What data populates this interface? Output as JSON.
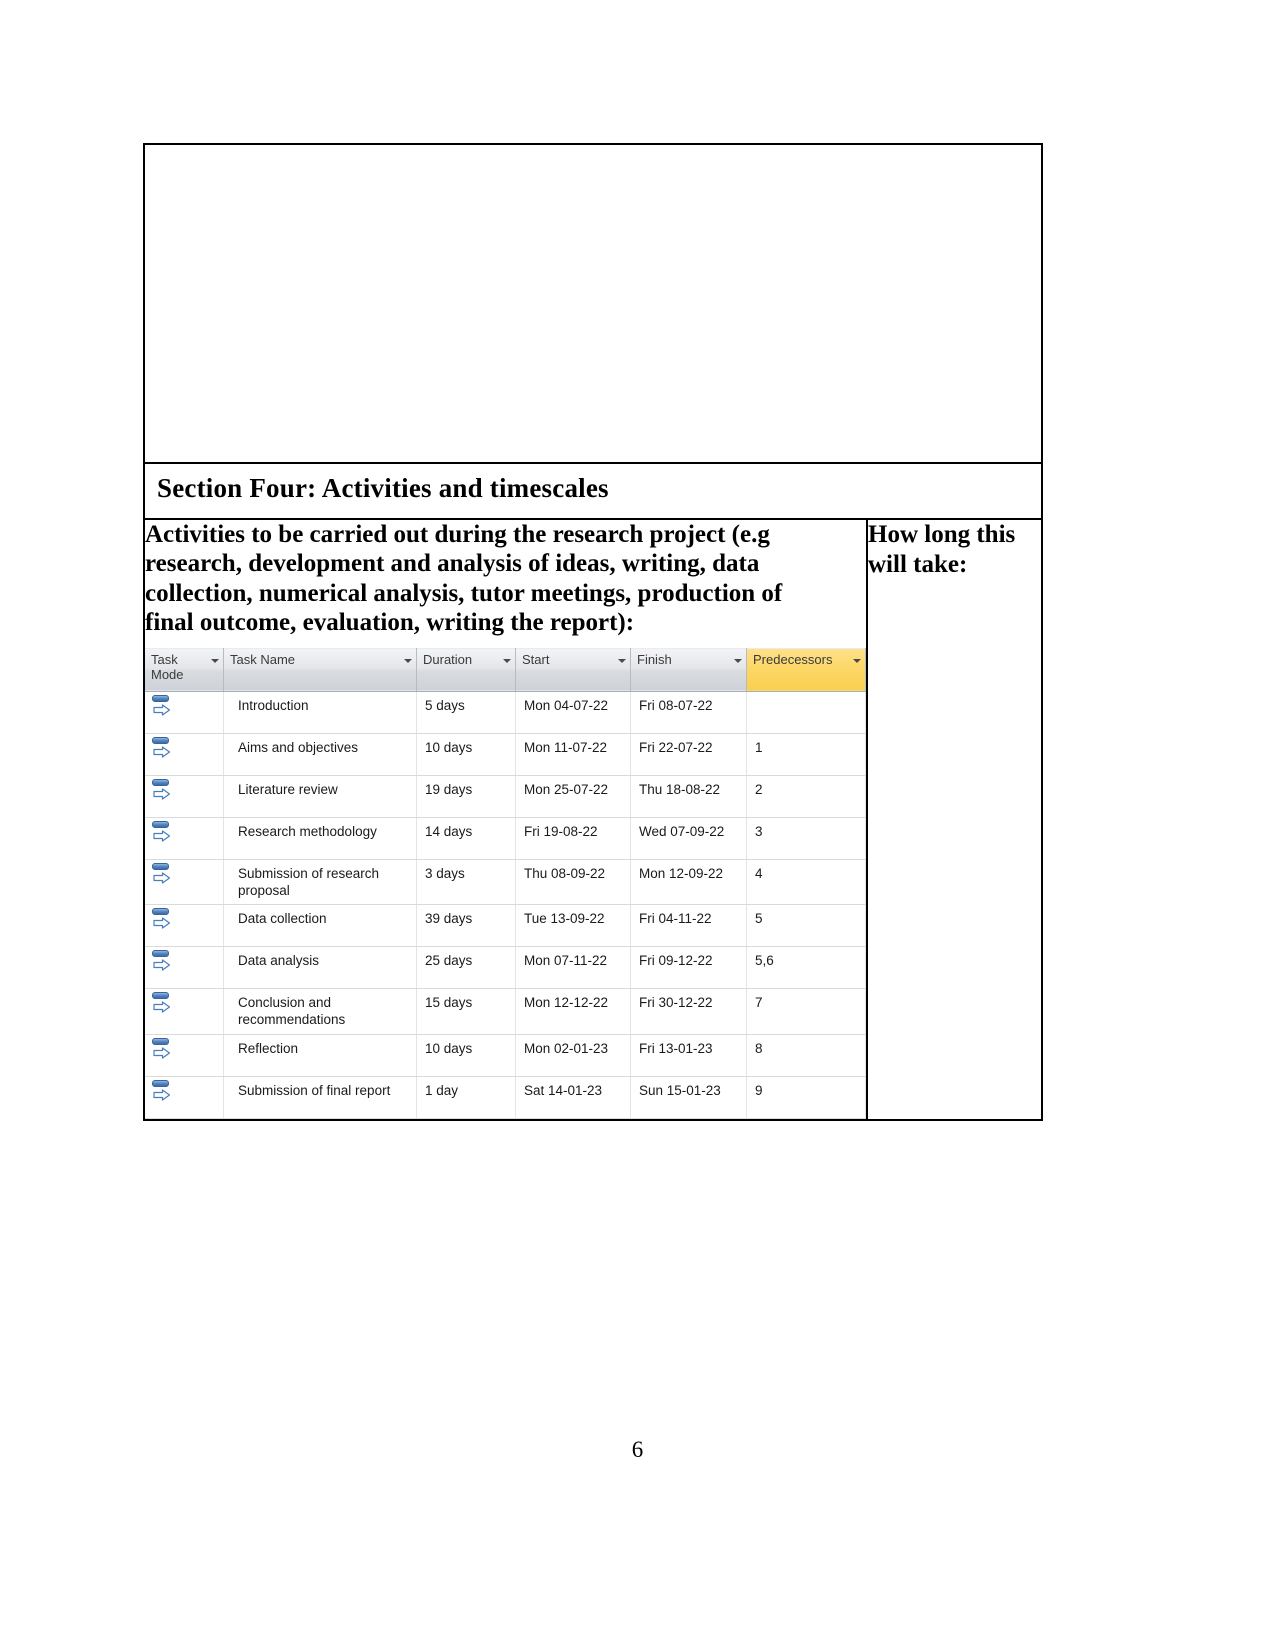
{
  "document": {
    "section_heading": "Section Four: Activities and timescales",
    "activities_prompt": "Activities to be carried out during the research project (e.g research, development and analysis of ideas, writing, data collection, numerical analysis, tutor meetings, production of final outcome, evaluation, writing the report):",
    "how_long_label": "How long this will take:",
    "page_number": "6"
  },
  "project_table": {
    "headers": [
      {
        "label": "Task Mode",
        "highlight": false
      },
      {
        "label": "Task Name",
        "highlight": false
      },
      {
        "label": "Duration",
        "highlight": false
      },
      {
        "label": "Start",
        "highlight": false
      },
      {
        "label": "Finish",
        "highlight": false
      },
      {
        "label": "Predecessors",
        "highlight": true
      }
    ],
    "accent_highlight_color": "#fbd65a",
    "header_background_color": "#dfe2e6",
    "rows": [
      {
        "mode": "auto-schedule-icon",
        "name": "Introduction",
        "duration": "5 days",
        "start": "Mon 04-07-22",
        "finish": "Fri 08-07-22",
        "predecessors": ""
      },
      {
        "mode": "auto-schedule-icon",
        "name": "Aims and objectives",
        "duration": "10 days",
        "start": "Mon 11-07-22",
        "finish": "Fri 22-07-22",
        "predecessors": "1"
      },
      {
        "mode": "auto-schedule-icon",
        "name": "Literature review",
        "duration": "19 days",
        "start": "Mon 25-07-22",
        "finish": "Thu 18-08-22",
        "predecessors": "2"
      },
      {
        "mode": "auto-schedule-icon",
        "name": "Research methodology",
        "duration": "14 days",
        "start": "Fri 19-08-22",
        "finish": "Wed 07-09-22",
        "predecessors": "3"
      },
      {
        "mode": "auto-schedule-icon",
        "name": "Submission of research proposal",
        "duration": "3 days",
        "start": "Thu 08-09-22",
        "finish": "Mon 12-09-22",
        "predecessors": "4"
      },
      {
        "mode": "auto-schedule-icon",
        "name": "Data collection",
        "duration": "39 days",
        "start": "Tue 13-09-22",
        "finish": "Fri 04-11-22",
        "predecessors": "5"
      },
      {
        "mode": "auto-schedule-icon",
        "name": "Data analysis",
        "duration": "25 days",
        "start": "Mon 07-11-22",
        "finish": "Fri 09-12-22",
        "predecessors": "5,6"
      },
      {
        "mode": "auto-schedule-icon",
        "name": "Conclusion and recommendations",
        "duration": "15 days",
        "start": "Mon 12-12-22",
        "finish": "Fri 30-12-22",
        "predecessors": "7"
      },
      {
        "mode": "auto-schedule-icon",
        "name": "Reflection",
        "duration": "10 days",
        "start": "Mon 02-01-23",
        "finish": "Fri 13-01-23",
        "predecessors": "8"
      },
      {
        "mode": "auto-schedule-icon",
        "name": "Submission of final report",
        "duration": "1 day",
        "start": "Sat 14-01-23",
        "finish": "Sun 15-01-23",
        "predecessors": "9"
      }
    ]
  }
}
